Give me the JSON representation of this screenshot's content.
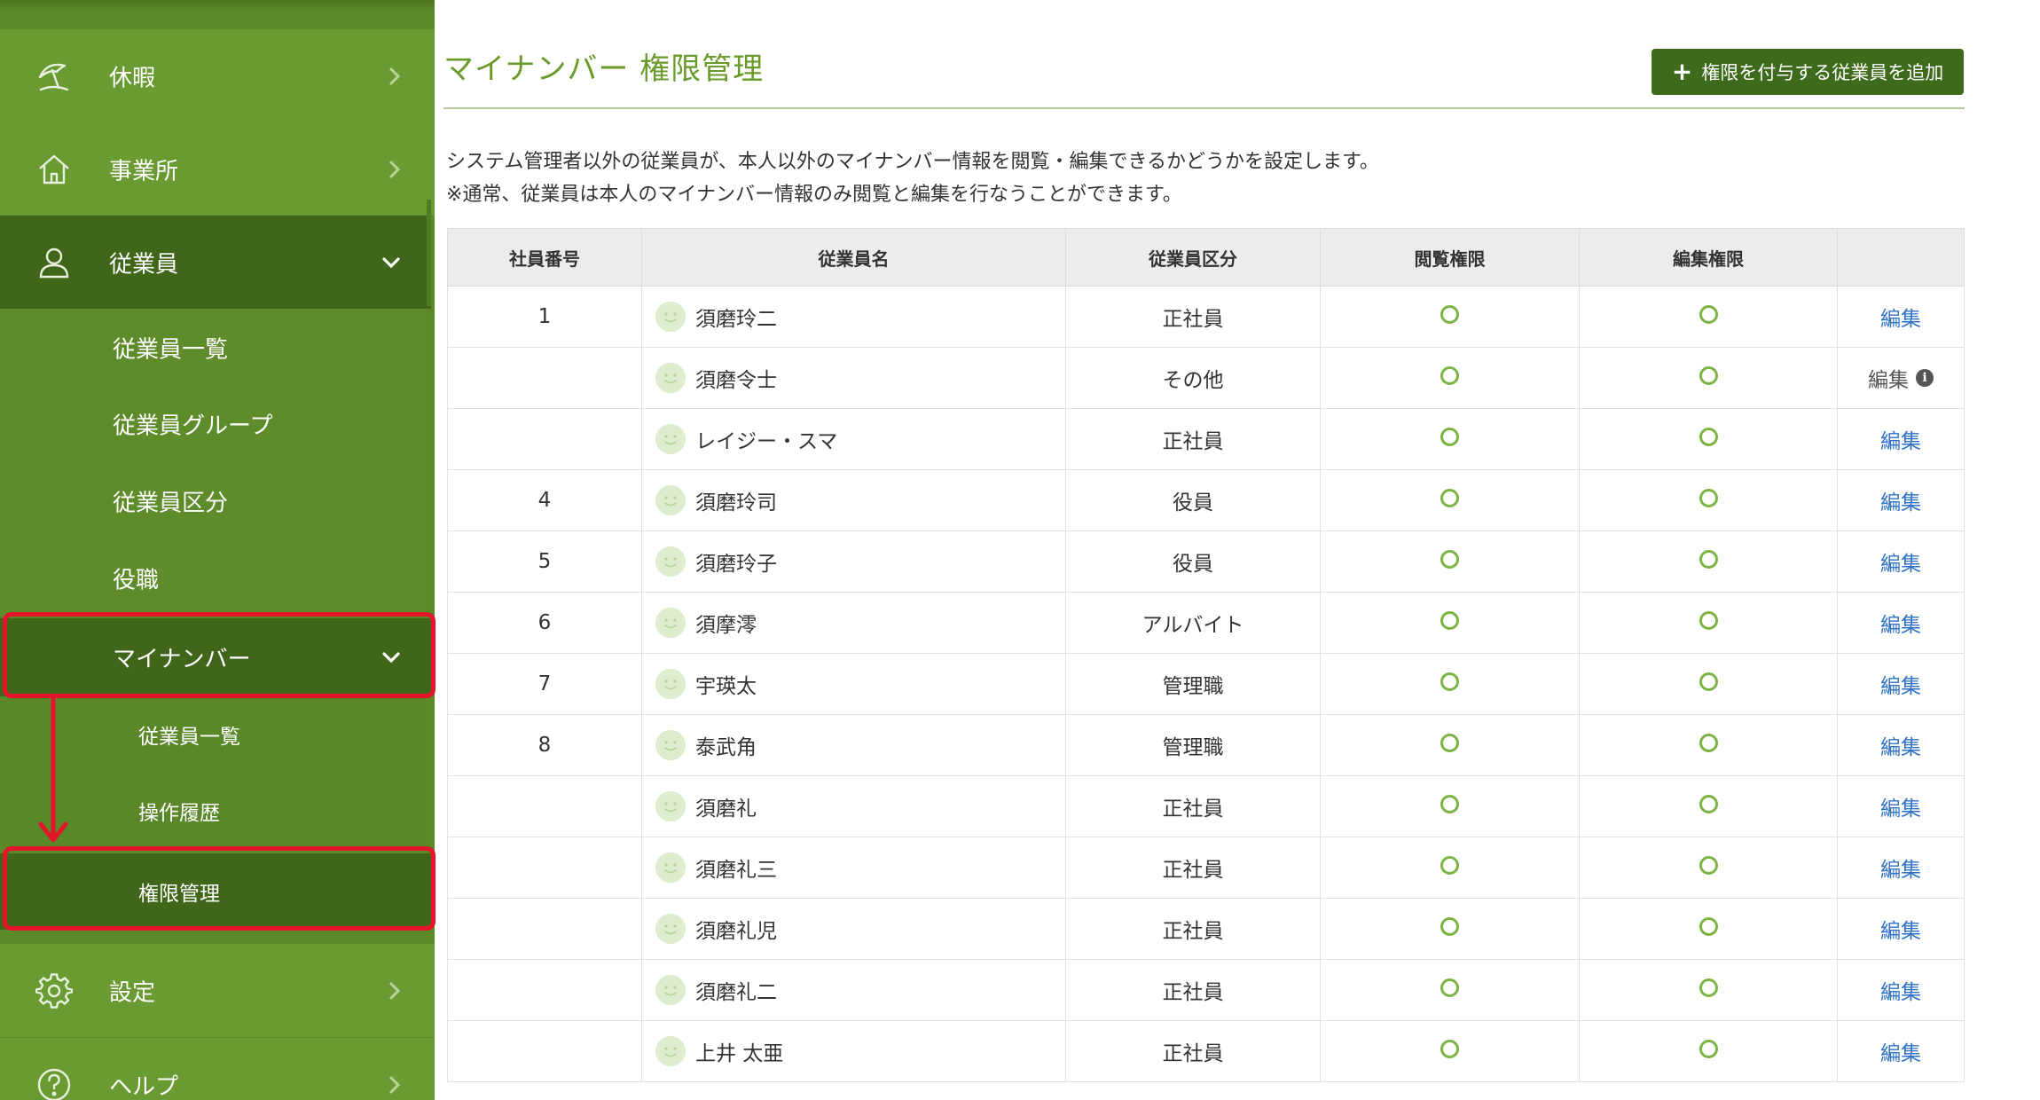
{
  "sidebar": {
    "items": [
      {
        "label": "休暇",
        "icon": "beach-umbrella-icon"
      },
      {
        "label": "事業所",
        "icon": "home-icon"
      },
      {
        "label": "従業員",
        "icon": "person-icon"
      }
    ],
    "employee_sub": [
      {
        "label": "従業員一覧"
      },
      {
        "label": "従業員グループ"
      },
      {
        "label": "従業員区分"
      },
      {
        "label": "役職"
      },
      {
        "label": "マイナンバー"
      }
    ],
    "mynumber_sub": [
      {
        "label": "従業員一覧"
      },
      {
        "label": "操作履歴"
      },
      {
        "label": "権限管理"
      }
    ],
    "bottom_items": [
      {
        "label": "設定",
        "icon": "gear-icon"
      },
      {
        "label": "ヘルプ",
        "icon": "help-icon"
      }
    ]
  },
  "header": {
    "title": "マイナンバー 権限管理",
    "add_button": "権限を付与する従業員を追加"
  },
  "description": {
    "line1": "システム管理者以外の従業員が、本人以外のマイナンバー情報を閲覧・編集できるかどうかを設定します。",
    "line2": "※通常、従業員は本人のマイナンバー情報のみ閲覧と編集を行なうことができます。"
  },
  "table": {
    "headers": [
      "社員番号",
      "従業員名",
      "従業員区分",
      "閲覧権限",
      "編集権限",
      ""
    ],
    "rows": [
      {
        "id": "1",
        "name": "須磨玲二",
        "category": "正社員",
        "view": true,
        "edit": true,
        "action": "編集",
        "action_enabled": true
      },
      {
        "id": "",
        "name": "須磨令士",
        "category": "その他",
        "view": true,
        "edit": true,
        "action": "編集",
        "action_enabled": false
      },
      {
        "id": "",
        "name": "レイジー・スマ",
        "category": "正社員",
        "view": true,
        "edit": true,
        "action": "編集",
        "action_enabled": true
      },
      {
        "id": "4",
        "name": "須磨玲司",
        "category": "役員",
        "view": true,
        "edit": true,
        "action": "編集",
        "action_enabled": true
      },
      {
        "id": "5",
        "name": "須磨玲子",
        "category": "役員",
        "view": true,
        "edit": true,
        "action": "編集",
        "action_enabled": true
      },
      {
        "id": "6",
        "name": "須摩澪",
        "category": "アルバイト",
        "view": true,
        "edit": true,
        "action": "編集",
        "action_enabled": true
      },
      {
        "id": "7",
        "name": "宇瑛太",
        "category": "管理職",
        "view": true,
        "edit": true,
        "action": "編集",
        "action_enabled": true
      },
      {
        "id": "8",
        "name": "泰武角",
        "category": "管理職",
        "view": true,
        "edit": true,
        "action": "編集",
        "action_enabled": true
      },
      {
        "id": "",
        "name": "須磨礼",
        "category": "正社員",
        "view": true,
        "edit": true,
        "action": "編集",
        "action_enabled": true
      },
      {
        "id": "",
        "name": "須磨礼三",
        "category": "正社員",
        "view": true,
        "edit": true,
        "action": "編集",
        "action_enabled": true
      },
      {
        "id": "",
        "name": "須磨礼児",
        "category": "正社員",
        "view": true,
        "edit": true,
        "action": "編集",
        "action_enabled": true
      },
      {
        "id": "",
        "name": "須磨礼二",
        "category": "正社員",
        "view": true,
        "edit": true,
        "action": "編集",
        "action_enabled": true
      },
      {
        "id": "",
        "name": "上井 太亜",
        "category": "正社員",
        "view": true,
        "edit": true,
        "action": "編集",
        "action_enabled": true
      }
    ]
  },
  "colors": {
    "sidebar_bg": "#5c8a28",
    "sidebar_active": "#3f6619",
    "accent": "#6a9a2a",
    "button": "#3e6b1b",
    "link": "#2f72c4",
    "highlight": "#e4142b"
  }
}
